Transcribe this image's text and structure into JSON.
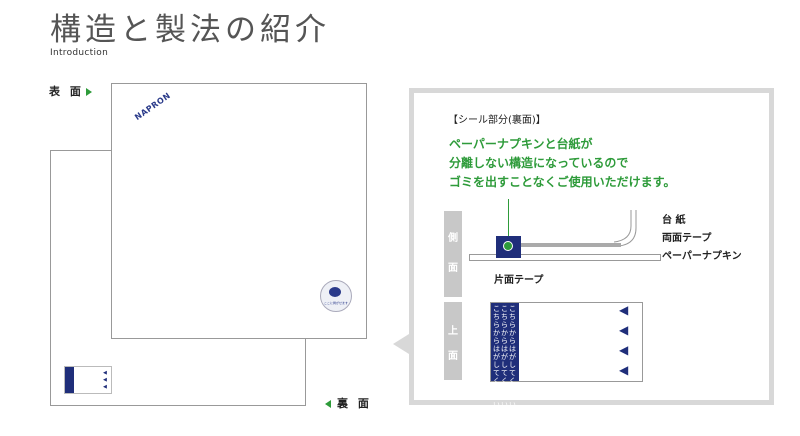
{
  "header": {
    "title": "構造と製法の紹介",
    "subtitle": "Introduction"
  },
  "labels": {
    "front": "表 面",
    "back": "裏 面"
  },
  "sheet": {
    "logo_text": "NAPRON",
    "seal_caption": "ここに剥がせます"
  },
  "panel": {
    "heading": "【シール部分(裏面)】",
    "message_lines": [
      "ペーパーナプキンと台紙が",
      "分離しない構造になっているので",
      "ゴミを出すことなくご使用いただけます。"
    ],
    "side_view_tag": [
      "側",
      "面"
    ],
    "top_view_tag": [
      "上",
      "面"
    ],
    "layer_labels": {
      "base": "台 紙",
      "double_tape": "両面テープ",
      "napkin": "ペーパーナプキン",
      "single_tape": "片面テープ"
    },
    "top_view_text": "こちらからはがしてください",
    "colors": {
      "accent_green": "#2e9b3a",
      "navy": "#1f2e7a",
      "frame_grey": "#d8d8d8"
    }
  }
}
